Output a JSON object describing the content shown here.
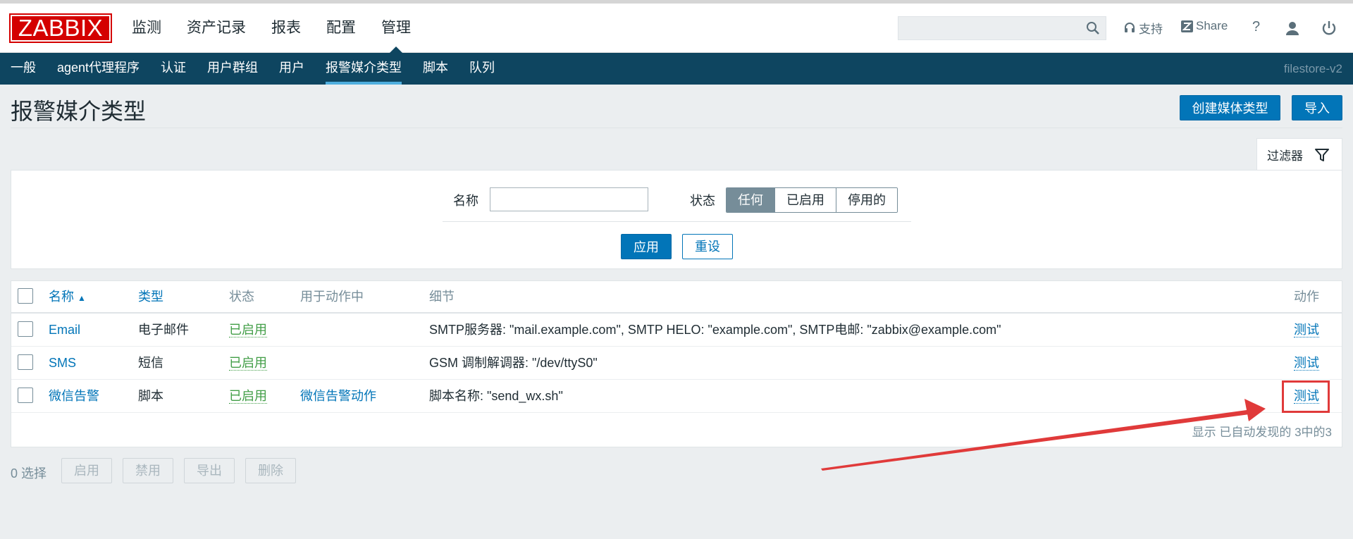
{
  "logo": "ZABBIX",
  "main_menu": [
    "监测",
    "资产记录",
    "报表",
    "配置",
    "管理"
  ],
  "header_right": {
    "support": "支持",
    "share": "Share",
    "help": "?"
  },
  "search": {
    "value": "",
    "placeholder": ""
  },
  "sub_menu": [
    "一般",
    "agent代理程序",
    "认证",
    "用户群组",
    "用户",
    "报警媒介类型",
    "脚本",
    "队列"
  ],
  "server_name": "filestore-v2",
  "page": {
    "title": "报警媒介类型",
    "create_button": "创建媒体类型",
    "import_button": "导入"
  },
  "filter": {
    "tab_label": "过滤器",
    "name_label": "名称",
    "name_value": "",
    "status_label": "状态",
    "status_options": [
      "任何",
      "已启用",
      "停用的"
    ],
    "status_selected": "任何",
    "apply_button": "应用",
    "reset_button": "重设"
  },
  "table": {
    "headers": {
      "name": "名称",
      "sort_indicator": "▲",
      "type": "类型",
      "status": "状态",
      "used_in_actions": "用于动作中",
      "details": "细节",
      "action": "动作"
    },
    "rows": [
      {
        "name": "Email",
        "type": "电子邮件",
        "status": "已启用",
        "used_in_actions": "",
        "details": "SMTP服务器: \"mail.example.com\", SMTP HELO: \"example.com\", SMTP电邮: \"zabbix@example.com\"",
        "action": "测试"
      },
      {
        "name": "SMS",
        "type": "短信",
        "status": "已启用",
        "used_in_actions": "",
        "details": "GSM 调制解调器: \"/dev/ttyS0\"",
        "action": "测试"
      },
      {
        "name": "微信告警",
        "type": "脚本",
        "status": "已启用",
        "used_in_actions": "微信告警动作",
        "details": "脚本名称: \"send_wx.sh\"",
        "action": "测试"
      }
    ],
    "footer": "显示 已自动发现的 3中的3"
  },
  "bulk": {
    "selected": "0 选择",
    "buttons": [
      "启用",
      "禁用",
      "导出",
      "删除"
    ]
  },
  "colors": {
    "brand": "#d40000",
    "nav": "#0e4560",
    "accent": "#0275b8",
    "enabled": "#429e47",
    "annotation": "#e03a3a"
  }
}
